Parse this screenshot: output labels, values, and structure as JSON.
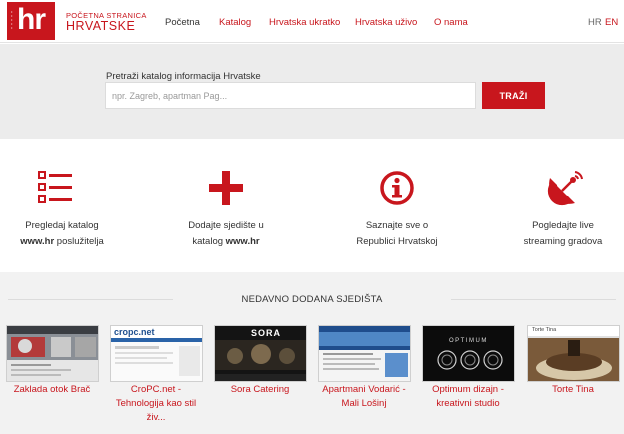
{
  "header": {
    "logo_text": "hr",
    "brand_small": "POČETNA STRANICA",
    "brand_big": "HRVATSKE",
    "nav": [
      {
        "label": "Početna"
      },
      {
        "label": "Katalog"
      },
      {
        "label": "Hrvatska ukratko"
      },
      {
        "label": "Hrvatska uživo"
      },
      {
        "label": "O nama"
      }
    ],
    "lang_hr": "HR",
    "lang_en": "EN"
  },
  "search": {
    "label": "Pretraži katalog informacija Hrvatske",
    "placeholder": "npr. Zagreb, apartman Pag...",
    "button": "TRAŽI"
  },
  "features": [
    {
      "icon": "list-icon",
      "line1": "Pregledaj katalog",
      "bold": "www.hr",
      "line2_rest": " poslužitelja"
    },
    {
      "icon": "plus-icon",
      "line1": "Dodajte sjedište u",
      "line2_pre": "katalog ",
      "bold": "www.hr"
    },
    {
      "icon": "info-icon",
      "line1": "Saznajte sve o",
      "line2": "Republici Hrvatskoj"
    },
    {
      "icon": "satellite-dish-icon",
      "line1": "Pogledajte live",
      "line2": "streaming gradova"
    }
  ],
  "recent": {
    "title": "NEDAVNO DODANA SJEDIŠTA",
    "items": [
      {
        "caption_1": "Zaklada otok Brač",
        "caption_2": "",
        "caption_3": ""
      },
      {
        "caption_1": "CroPC.net -",
        "caption_2": "Tehnologija kao stil",
        "caption_3": "živ...",
        "thumb_logo": "cropc.net"
      },
      {
        "caption_1": "Sora Catering",
        "caption_2": "",
        "caption_3": "",
        "thumb_logo": "SORA"
      },
      {
        "caption_1": "Apartmani Vodarić -",
        "caption_2": "Mali Lošinj",
        "caption_3": ""
      },
      {
        "caption_1": "Optimum dizajn -",
        "caption_2": "kreativni studio",
        "caption_3": "",
        "thumb_logo": "OPTIMUM"
      },
      {
        "caption_1": "Torte Tina",
        "caption_2": "",
        "caption_3": "",
        "thumb_logo": "Torte Tina"
      }
    ]
  },
  "colors": {
    "accent": "#c8161d",
    "band": "#ececec"
  }
}
